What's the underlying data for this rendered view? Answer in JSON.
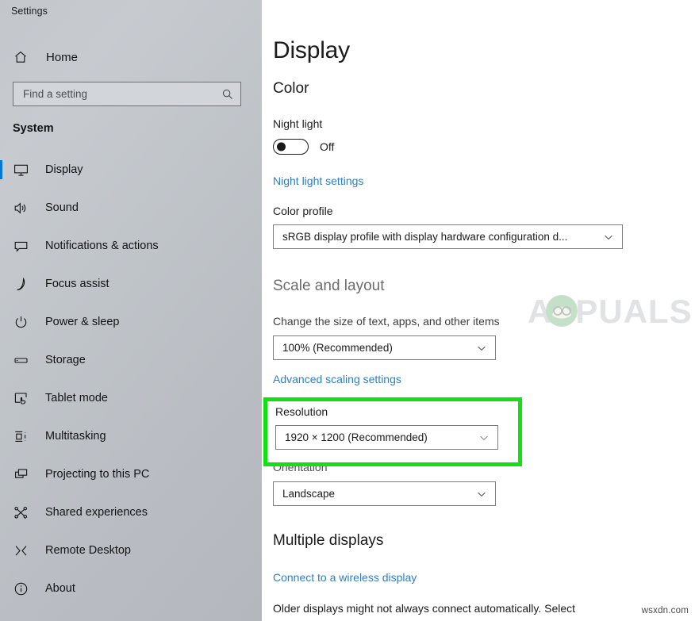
{
  "window": {
    "title": "Settings"
  },
  "sidebar": {
    "home": {
      "label": "Home",
      "icon": "home-icon"
    },
    "search": {
      "placeholder": "Find a setting",
      "icon": "search-icon"
    },
    "group_title": "System",
    "items": [
      {
        "label": "Display",
        "icon": "monitor-icon",
        "selected": true
      },
      {
        "label": "Sound",
        "icon": "speaker-icon",
        "selected": false
      },
      {
        "label": "Notifications & actions",
        "icon": "notification-icon",
        "selected": false
      },
      {
        "label": "Focus assist",
        "icon": "moon-icon",
        "selected": false
      },
      {
        "label": "Power & sleep",
        "icon": "power-icon",
        "selected": false
      },
      {
        "label": "Storage",
        "icon": "drive-icon",
        "selected": false
      },
      {
        "label": "Tablet mode",
        "icon": "tablet-icon",
        "selected": false
      },
      {
        "label": "Multitasking",
        "icon": "multitasking-icon",
        "selected": false
      },
      {
        "label": "Projecting to this PC",
        "icon": "project-icon",
        "selected": false
      },
      {
        "label": "Shared experiences",
        "icon": "share-icon",
        "selected": false
      },
      {
        "label": "Remote Desktop",
        "icon": "remote-desktop-icon",
        "selected": false
      },
      {
        "label": "About",
        "icon": "info-icon",
        "selected": false
      }
    ],
    "accent_color": "#0078d4"
  },
  "main": {
    "page_title": "Display",
    "sections": {
      "color": {
        "heading": "Color",
        "night_light_label": "Night light",
        "night_light_state": "Off",
        "night_light_on": false,
        "night_light_link": "Night light settings",
        "color_profile_label": "Color profile",
        "color_profile_value": "sRGB display profile with display hardware configuration d..."
      },
      "scale_and_layout": {
        "heading": "Scale and layout",
        "change_size_label": "Change the size of text, apps, and other items",
        "scale_value": "100% (Recommended)",
        "advanced_scaling_link": "Advanced scaling settings",
        "resolution_label": "Resolution",
        "resolution_value": "1920 × 1200 (Recommended)",
        "orientation_label": "Orientation",
        "orientation_value": "Landscape"
      },
      "multiple_displays": {
        "heading": "Multiple displays",
        "wireless_link": "Connect to a wireless display",
        "note": "Older displays might not always connect automatically. Select"
      }
    }
  },
  "annotations": {
    "highlight_color": "#13e013",
    "highlight_target": "Resolution"
  },
  "watermarks": {
    "brand": "APPUALS",
    "site": "wsxdn.com"
  }
}
